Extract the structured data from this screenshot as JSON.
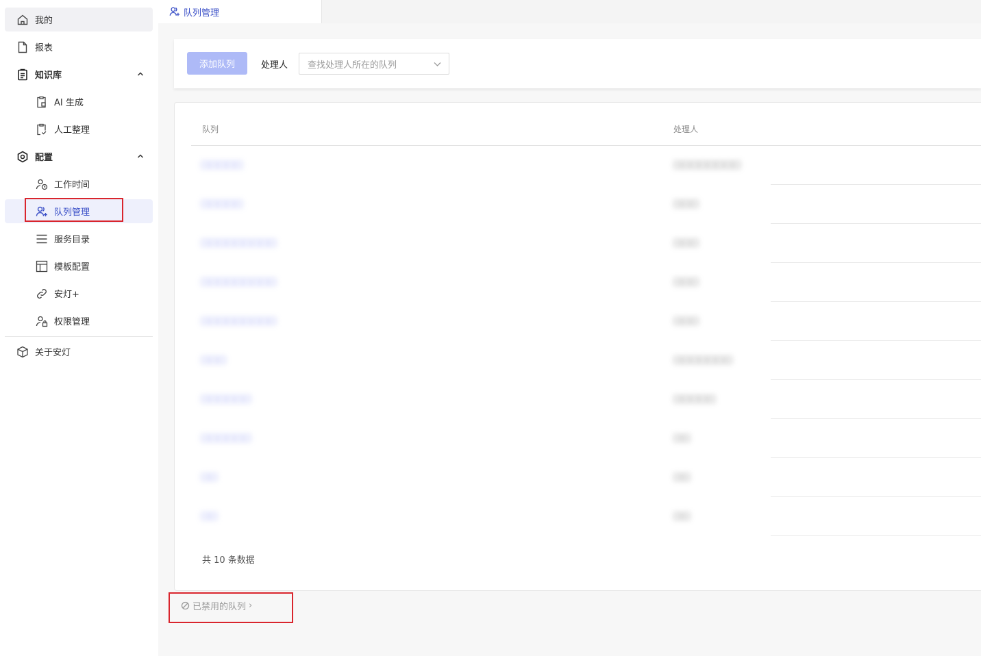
{
  "sidebar": {
    "items": [
      {
        "label": "我的"
      },
      {
        "label": "报表"
      },
      {
        "label": "知识库"
      },
      {
        "label": "AI 生成"
      },
      {
        "label": "人工整理"
      },
      {
        "label": "配置"
      },
      {
        "label": "工作时间"
      },
      {
        "label": "队列管理"
      },
      {
        "label": "服务目录"
      },
      {
        "label": "模板配置"
      },
      {
        "label": "安灯+"
      },
      {
        "label": "权限管理"
      },
      {
        "label": "关于安灯"
      }
    ]
  },
  "tab": {
    "label": "队列管理"
  },
  "toolbar": {
    "add_label": "添加队列",
    "handler_label": "处理人",
    "handler_placeholder": "查找处理人所在的队列"
  },
  "table": {
    "headers": [
      "队列",
      "处理人"
    ],
    "rows": [
      {
        "queue": "□□□□□",
        "handler": "□□□□□□□□"
      },
      {
        "queue": "□□□□□",
        "handler": "□□□"
      },
      {
        "queue": "□□□□□□□□□",
        "handler": "□□□"
      },
      {
        "queue": "□□□□□□□□□",
        "handler": "□□□"
      },
      {
        "queue": "□□□□□□□□□",
        "handler": "□□□"
      },
      {
        "queue": "□□□",
        "handler": "□□□□□□□"
      },
      {
        "queue": "□□□□□□",
        "handler": "□□□□□"
      },
      {
        "queue": "□□□□□□",
        "handler": "□□"
      },
      {
        "queue": "□□",
        "handler": "□□"
      },
      {
        "queue": "□□",
        "handler": "□□"
      }
    ],
    "total": "共 10 条数据"
  },
  "footer": {
    "disabled_label": "已禁用的队列",
    "arrow": "›"
  },
  "colors": {
    "accent": "#3a4fc7",
    "button_disabled": "#aebaf7",
    "highlight": "#d9252d"
  }
}
